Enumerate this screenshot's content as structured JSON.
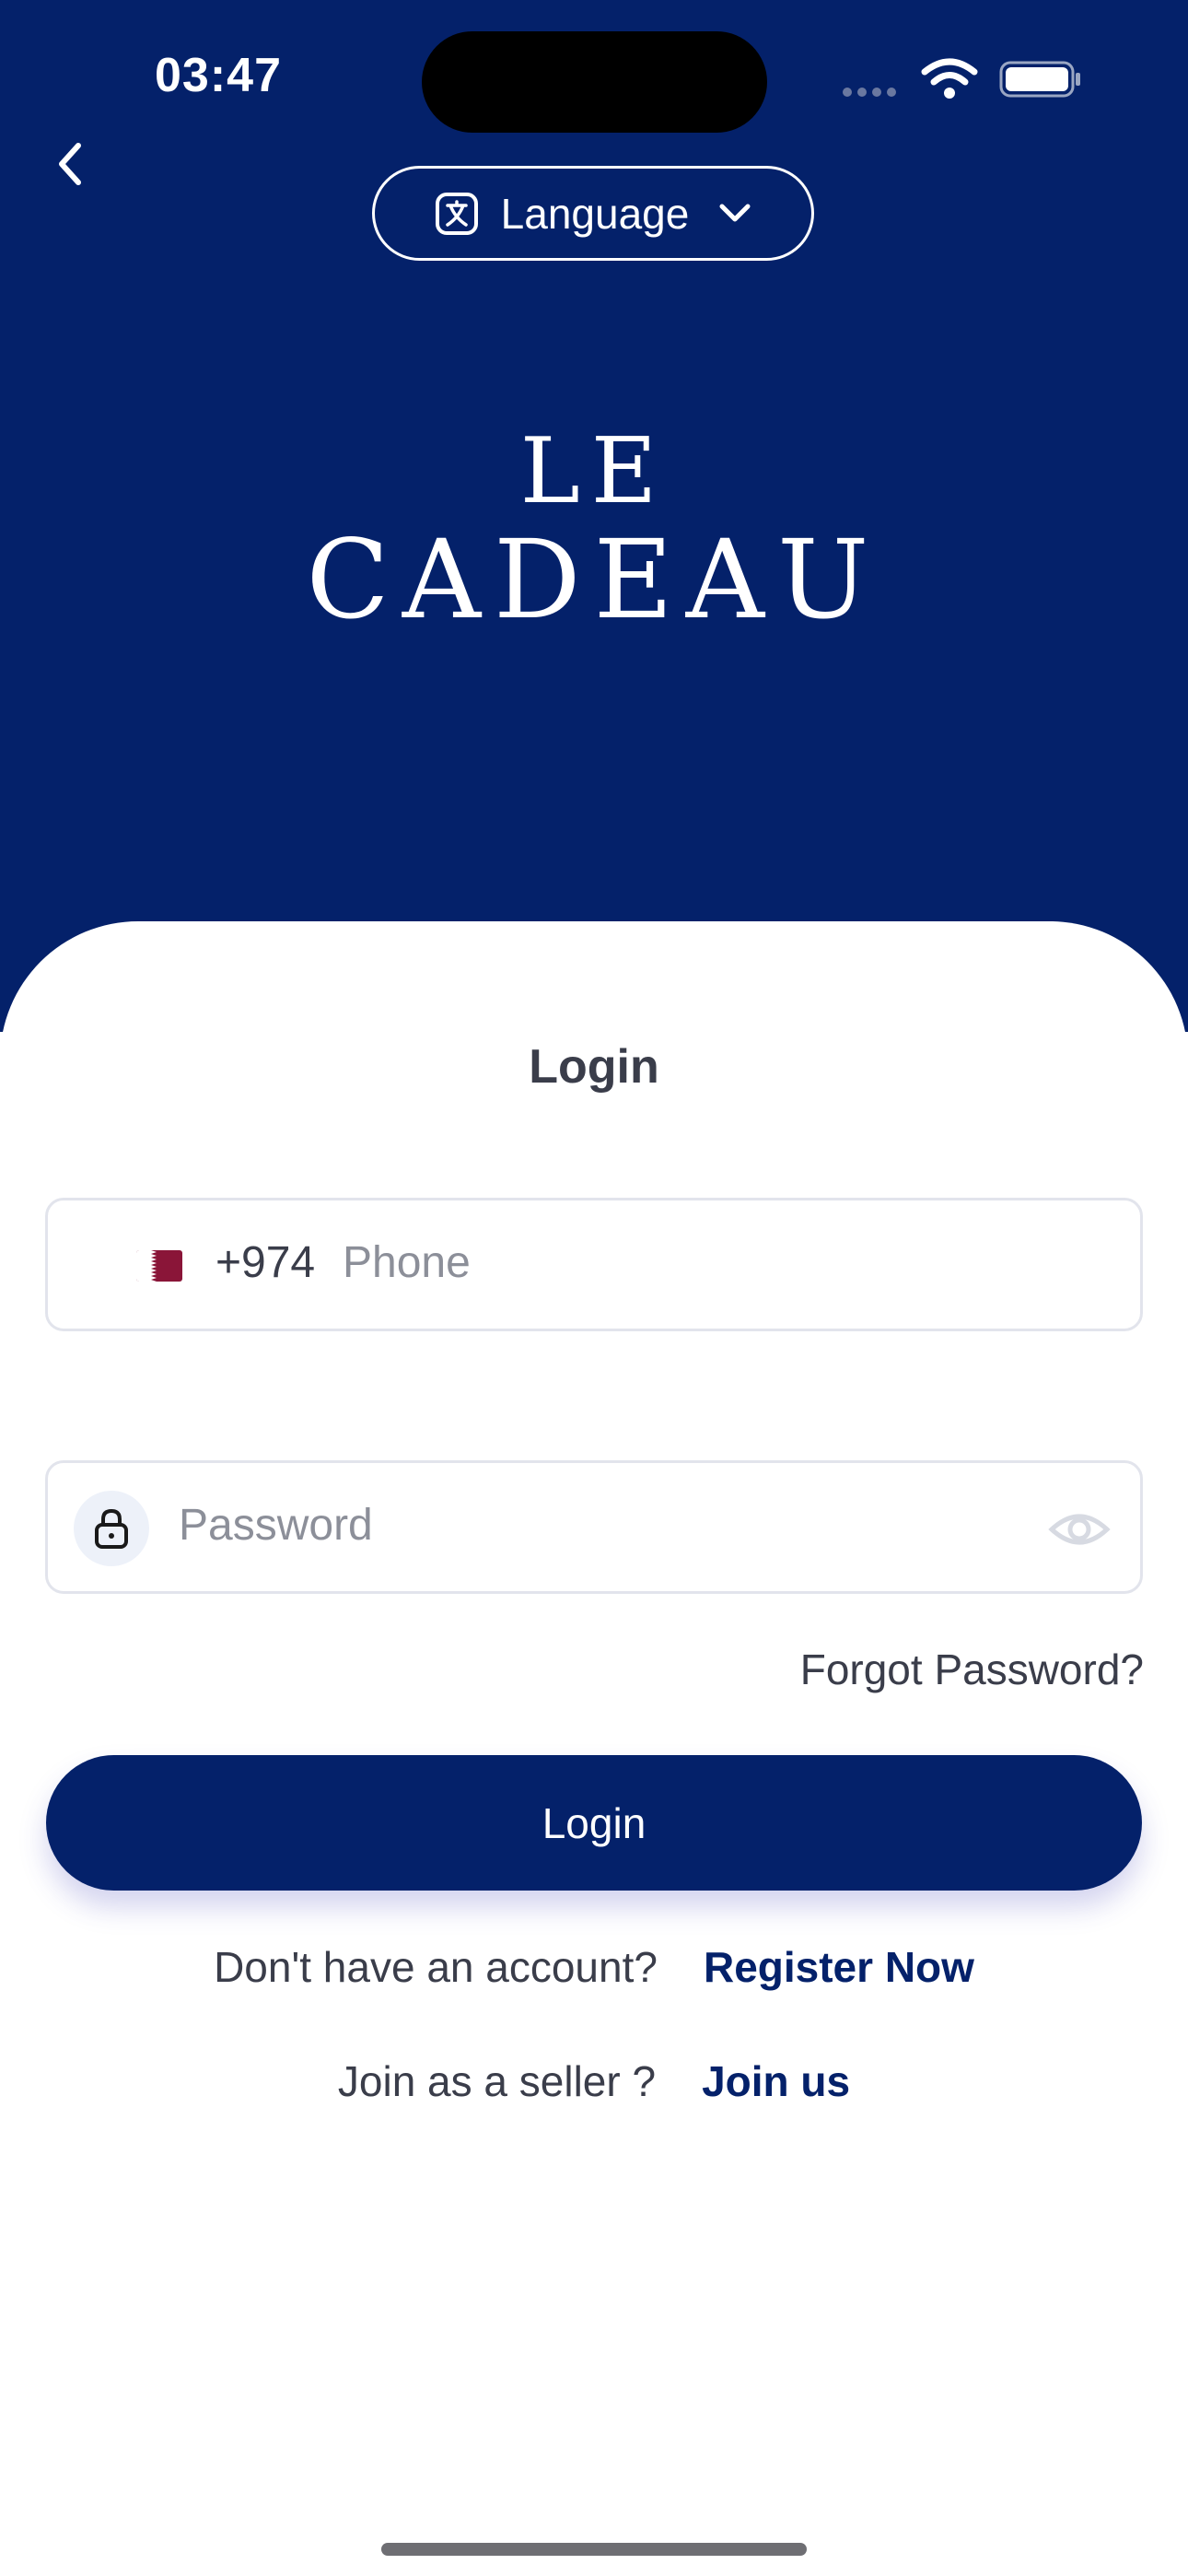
{
  "status_bar": {
    "time": "03:47"
  },
  "header": {
    "language_label": "Language",
    "logo_line1": "LE",
    "logo_line2": "CADEAU",
    "background_color": "#04216a"
  },
  "form": {
    "title": "Login",
    "phone": {
      "country_code": "+974",
      "placeholder": "Phone",
      "flag": "qatar-flag"
    },
    "password": {
      "placeholder": "Password"
    },
    "forgot_password": "Forgot Password?",
    "login_button": "Login"
  },
  "footer": {
    "no_account_text": "Don't have an account?",
    "register_link": "Register Now",
    "seller_text": "Join as a seller ?",
    "join_link": "Join us"
  },
  "icons": {
    "back": "chevron-left-icon",
    "language": "translate-icon",
    "dropdown": "chevron-down-icon",
    "lock": "lock-icon",
    "eye": "eye-icon",
    "wifi": "wifi-icon",
    "battery": "battery-icon"
  },
  "colors": {
    "accent": "#04216a",
    "text": "#3a3d4a",
    "placeholder": "#8c8f99",
    "border": "#e2e4ec"
  }
}
